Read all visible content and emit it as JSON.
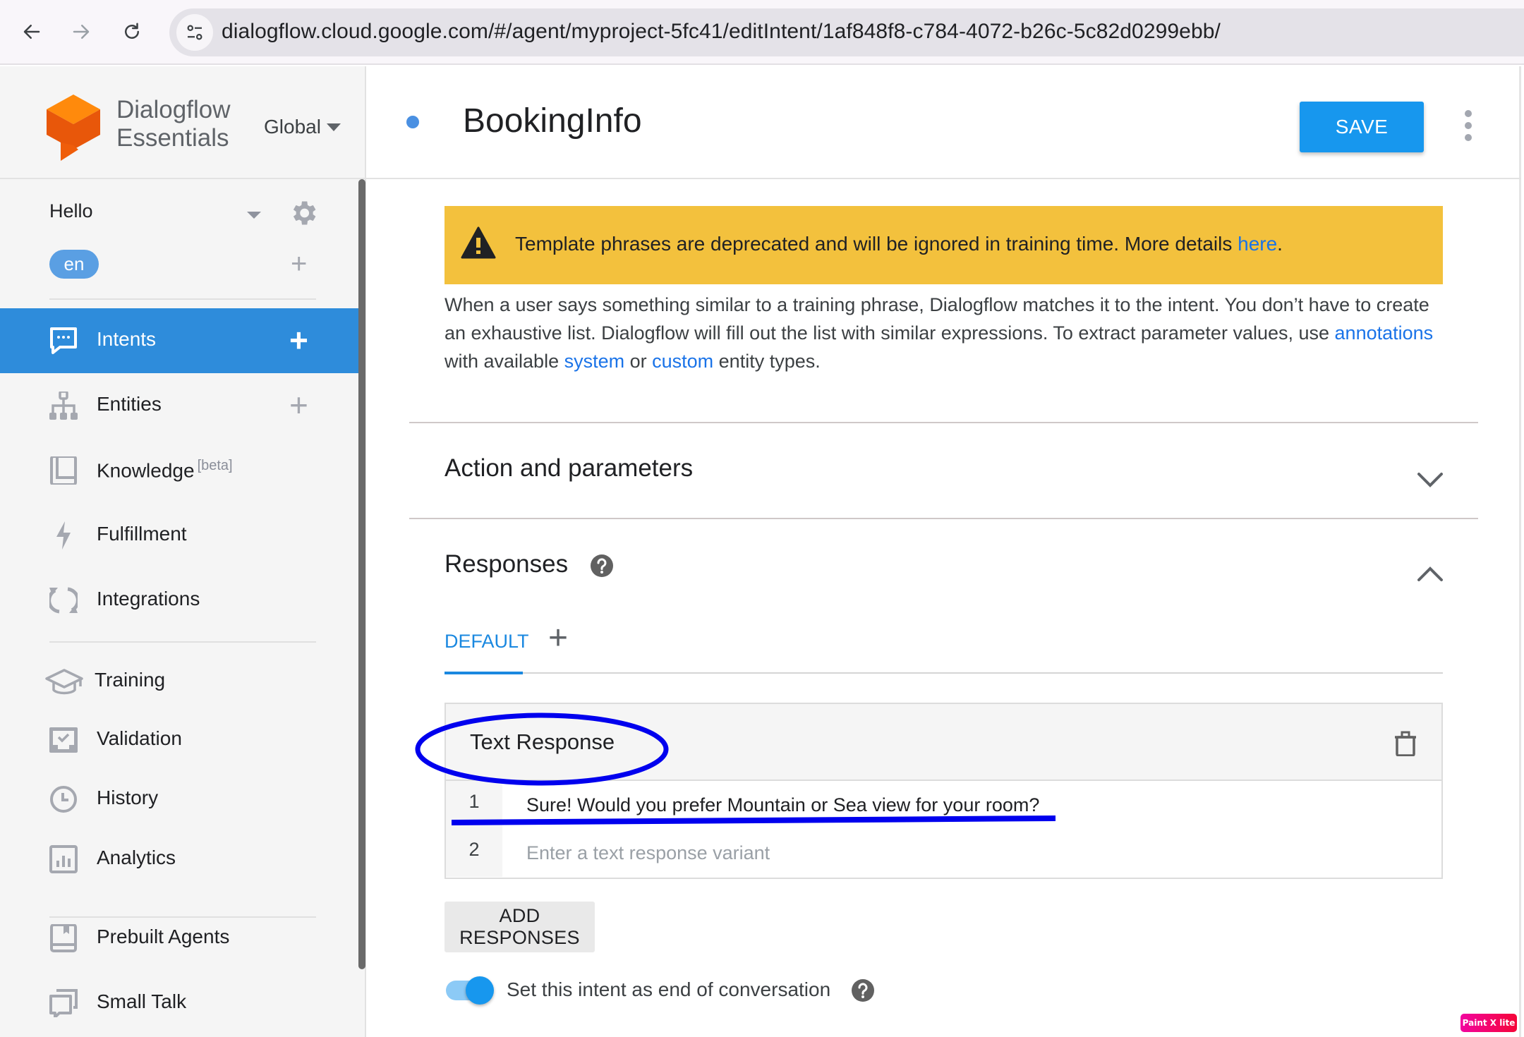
{
  "browser": {
    "url": "dialogflow.cloud.google.com/#/agent/myproject-5fc41/editIntent/1af848f8-c784-4072-b26c-5c82d0299ebb/"
  },
  "sidebar": {
    "brand_line1": "Dialogflow",
    "brand_line2": "Essentials",
    "region": "Global",
    "agent_name": "Hello",
    "language": "en",
    "items": [
      {
        "label": "Intents",
        "icon": "chat-bubble-icon",
        "active": true,
        "has_add": true
      },
      {
        "label": "Entities",
        "icon": "hierarchy-icon",
        "active": false,
        "has_add": true
      },
      {
        "label": "Knowledge",
        "badge": "[beta]",
        "icon": "book-icon",
        "active": false
      },
      {
        "label": "Fulfillment",
        "icon": "lightning-icon",
        "active": false
      },
      {
        "label": "Integrations",
        "icon": "sync-icon",
        "active": false
      },
      {
        "label": "Training",
        "icon": "graduation-cap-icon",
        "active": false
      },
      {
        "label": "Validation",
        "icon": "validation-inbox-icon",
        "active": false
      },
      {
        "label": "History",
        "icon": "clock-icon",
        "active": false
      },
      {
        "label": "Analytics",
        "icon": "bar-chart-icon",
        "active": false
      },
      {
        "label": "Prebuilt Agents",
        "icon": "bookmark-book-icon",
        "active": false
      },
      {
        "label": "Small Talk",
        "icon": "chat-stack-icon",
        "active": false
      }
    ]
  },
  "header": {
    "intent_name": "BookingInfo",
    "save_label": "SAVE",
    "status_color": "#4a90e2"
  },
  "warning": {
    "text": "Template phrases are deprecated and will be ignored in training time. More details ",
    "link": "here",
    "end": "."
  },
  "description": {
    "part1": "When a user says something similar to a training phrase, Dialogflow matches it to the intent. You don’t have to create an exhaustive list. Dialogflow will fill out the list with similar expressions. To extract parameter values, use ",
    "link1": "annotations",
    "part2": " with available ",
    "link2": "system",
    "part3": " or ",
    "link3": "custom",
    "part4": " entity types."
  },
  "sections": {
    "action_title": "Action and parameters",
    "action_expanded": false,
    "responses_title": "Responses",
    "responses_expanded": true
  },
  "responses": {
    "tab_default": "DEFAULT",
    "card_title": "Text Response",
    "rows": [
      {
        "num": "1",
        "value": "Sure! Would you prefer Mountain or Sea view for your room?",
        "placeholder": ""
      },
      {
        "num": "2",
        "value": "",
        "placeholder": "Enter a text response variant"
      }
    ],
    "add_label": "ADD RESPONSES",
    "end_conversation_label": "Set this intent as end of conversation",
    "end_conversation_on": true
  },
  "colors": {
    "accent": "#1797ee",
    "active_nav": "#2e8cdb",
    "warning": "#f3c13d",
    "link": "#1a73e8",
    "annotation": "#0000ee"
  },
  "watermark": "Paint X lite"
}
